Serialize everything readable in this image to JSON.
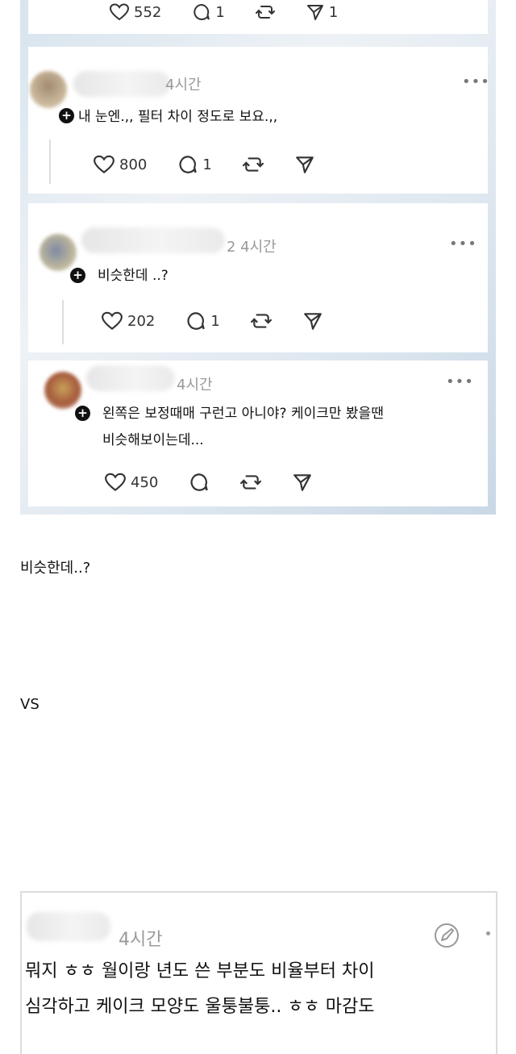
{
  "posts": [
    {
      "likes": "552",
      "replies": "1",
      "shares": "1"
    },
    {
      "time": "4시간",
      "text": "내 눈엔.,, 필터 차이 정도로 보요.,,",
      "likes": "800",
      "replies": "1"
    },
    {
      "time": "2 4시간",
      "text": "비슷한데 ..?",
      "likes": "202",
      "replies": "1"
    },
    {
      "time": "4시간",
      "text_lines": [
        "왼쪽은 보정때매 구런고 아니야?  케이크만 봤을땐",
        "비슷해보이는데..."
      ],
      "likes": "450"
    }
  ],
  "body": {
    "line1": "비슷한데..?",
    "line2": "VS"
  },
  "bottom_post": {
    "time": "4시간",
    "lines": [
      "뭐지 ㅎㅎ 월이랑 년도 쓴 부분도 비율부터 차이",
      "심각하고 케이크 모양도 울퉁불퉁.. ㅎㅎ 마감도"
    ]
  },
  "icons": [
    "heart-icon",
    "reply-icon",
    "repost-icon",
    "share-icon",
    "more-icon",
    "follow-plus-icon",
    "edit-icon"
  ]
}
